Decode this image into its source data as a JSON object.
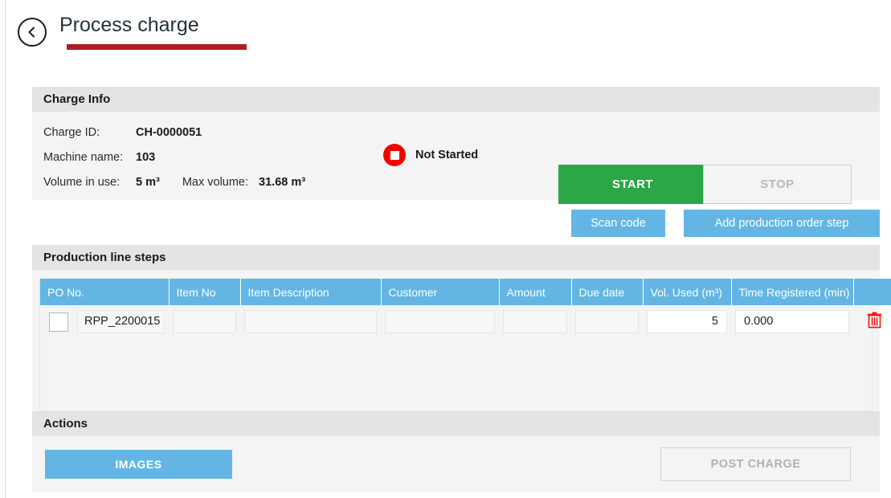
{
  "header": {
    "back_icon": "chevron-left-icon",
    "title": "Process charge",
    "accent_color": "#b31b22"
  },
  "charge_info": {
    "section_title": "Charge Info",
    "fields": [
      {
        "label": "Charge ID:",
        "value": "CH-0000051"
      },
      {
        "label": "Machine name:",
        "value": "103"
      }
    ],
    "volume": {
      "label": "Volume in use:",
      "value": "5 m³",
      "max_label": "Max volume:",
      "max_value": "31.68 m³"
    },
    "status": {
      "icon": "stop-status-icon",
      "text": "Not Started",
      "color": "#f50000"
    },
    "start_button": "START",
    "stop_button": "STOP",
    "start_color": "#2ba745"
  },
  "toolbar": {
    "scan_code": "Scan code",
    "add_production_order_step": "Add production order step",
    "blue": "#63b6e4"
  },
  "production_steps": {
    "section_title": "Production line steps",
    "columns": [
      "PO No.",
      "Item No",
      "Item Description",
      "Customer",
      "Amount",
      "Due date",
      "Vol. Used (m³)",
      "Time Registered (min)",
      ""
    ],
    "rows": [
      {
        "selected": false,
        "po_no": "RPP_2200015",
        "item_no": "",
        "item_description": "",
        "customer": "",
        "amount": "",
        "due_date": "",
        "vol_used": "5",
        "time_registered": "0.000",
        "delete_icon": "trash-icon"
      }
    ]
  },
  "actions": {
    "section_title": "Actions",
    "images_button": "IMAGES",
    "post_charge_button": "POST CHARGE"
  }
}
